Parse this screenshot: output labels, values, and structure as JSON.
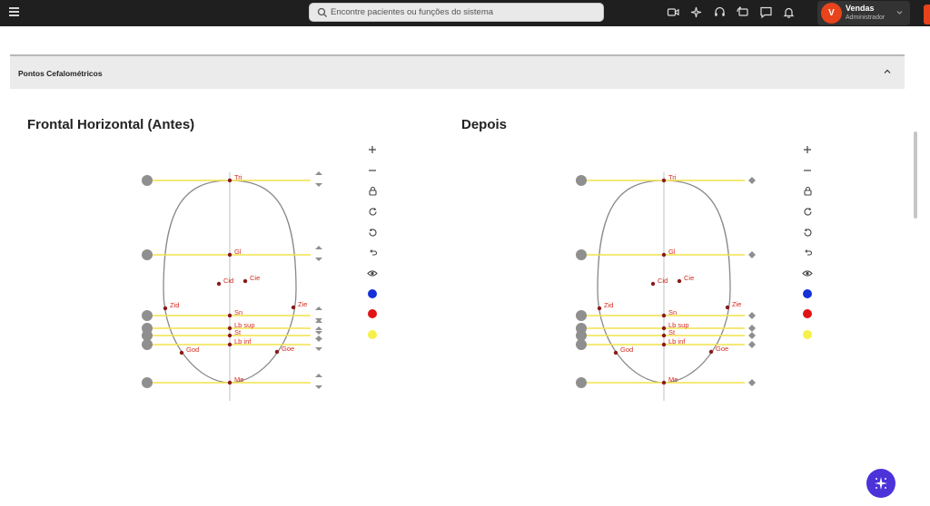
{
  "search": {
    "placeholder": "Encontre pacientes ou funções do sistema"
  },
  "user": {
    "initial": "V",
    "name": "Vendas",
    "role": "Administrador"
  },
  "section": {
    "title": "Pontos Cefalométricos"
  },
  "panels": [
    {
      "title": "Frontal Horizontal (Antes)"
    },
    {
      "title": "Depois"
    }
  ],
  "points": [
    {
      "label": "Tri"
    },
    {
      "label": "Gl"
    },
    {
      "label": "Cid"
    },
    {
      "label": "Cie"
    },
    {
      "label": "Zid"
    },
    {
      "label": "Zie"
    },
    {
      "label": "Sn"
    },
    {
      "label": "Lb sup"
    },
    {
      "label": "St"
    },
    {
      "label": "Lb inf"
    },
    {
      "label": "God"
    },
    {
      "label": "Goe"
    },
    {
      "label": "Me"
    }
  ],
  "colors": {
    "line": "#f2e24a",
    "point": "#8a1a1a",
    "label": "#d42a1e",
    "blue": "#1530d8",
    "red": "#e01414",
    "yellow": "#f6f04a"
  },
  "icons": [
    "menu-icon",
    "search-icon",
    "video-icon",
    "ai-sparkle-icon",
    "headset-icon",
    "refresh-message-icon",
    "chat-icon",
    "bell-icon",
    "chevron-down-icon",
    "chevron-up-icon",
    "plus-icon",
    "minus-icon",
    "lock-icon",
    "rotate-cw-icon",
    "rotate-ccw-icon",
    "undo-icon",
    "eye-icon",
    "sparkle-icon"
  ]
}
